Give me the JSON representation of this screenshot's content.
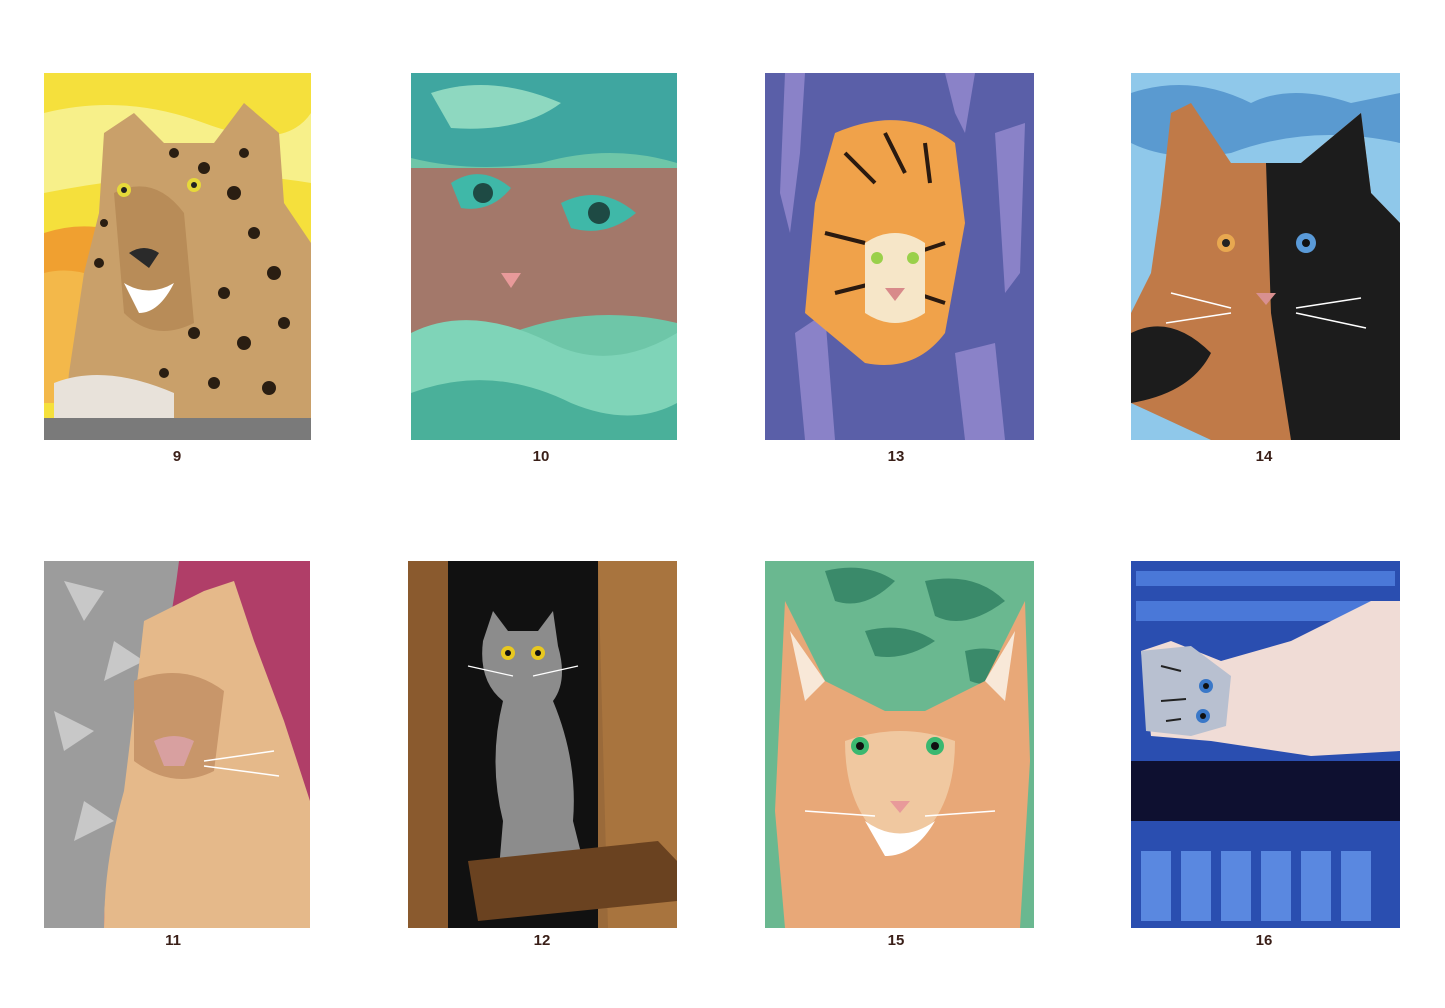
{
  "cards": [
    {
      "number": "9",
      "subject": "leopard",
      "colors": {
        "bg": "#f5e03c",
        "main": "#c9a06a",
        "accent": "#e9a233"
      }
    },
    {
      "number": "10",
      "subject": "cat-in-blanket",
      "colors": {
        "bg": "#6ec6a8",
        "main": "#a3786a",
        "accent": "#3fa6a0"
      }
    },
    {
      "number": "13",
      "subject": "tiger",
      "colors": {
        "bg": "#5a5fa8",
        "main": "#f0a24a",
        "accent": "#8a82c8"
      }
    },
    {
      "number": "14",
      "subject": "two-faced-cat",
      "colors": {
        "bg": "#8fc8ea",
        "main": "#c07a48",
        "accent": "#1c1c1c"
      }
    },
    {
      "number": "11",
      "subject": "puma",
      "colors": {
        "bg": "#b03e68",
        "main": "#e5b98a",
        "accent": "#9c9c9c"
      }
    },
    {
      "number": "12",
      "subject": "grey-cat",
      "colors": {
        "bg": "#9a6a3a",
        "main": "#8c8c8c",
        "accent": "#111111"
      }
    },
    {
      "number": "15",
      "subject": "lynx",
      "colors": {
        "bg": "#6ab890",
        "main": "#e8a878",
        "accent": "#3a8a6a"
      }
    },
    {
      "number": "16",
      "subject": "cat-on-blue-rack",
      "colors": {
        "bg": "#2a4eb0",
        "main": "#f0dcd6",
        "accent": "#1a1a40"
      }
    }
  ]
}
